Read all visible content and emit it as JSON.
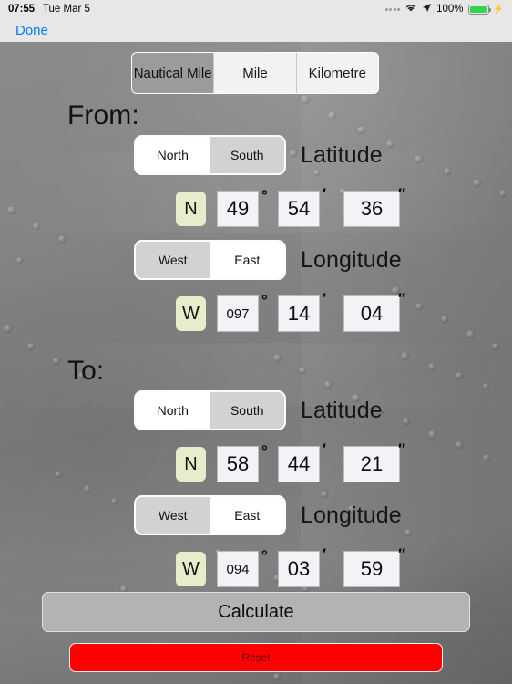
{
  "statusbar": {
    "time": "07:55",
    "date": "Tue Mar 5",
    "battery_percent": "100%",
    "signal_icon": "signal-dots-icon",
    "wifi_icon": "wifi-icon",
    "location_icon": "location-arrow-icon",
    "battery_icon": "battery-full-icon",
    "charging_icon": "charging-bolt-icon"
  },
  "navbar": {
    "done_label": "Done",
    "done_color": "#007AFF"
  },
  "unit_selector": {
    "options": [
      "Nautical Mile",
      "Mile",
      "Kilometre"
    ],
    "selected": "Nautical Mile"
  },
  "from": {
    "heading": "From:",
    "latitude": {
      "label": "Latitude",
      "options": [
        "North",
        "South"
      ],
      "selected": "North",
      "hemisphere": "N",
      "degrees": "49",
      "minutes": "54",
      "seconds": "36",
      "degree_mark": "°",
      "minute_mark": "′",
      "second_mark": "″"
    },
    "longitude": {
      "label": "Longitude",
      "options": [
        "West",
        "East"
      ],
      "selected": "East",
      "hemisphere": "W",
      "degrees": "097",
      "minutes": "14",
      "seconds": "04",
      "degree_mark": "°",
      "minute_mark": "′",
      "second_mark": "″"
    }
  },
  "to": {
    "heading": "To:",
    "latitude": {
      "label": "Latitude",
      "options": [
        "North",
        "South"
      ],
      "selected": "North",
      "hemisphere": "N",
      "degrees": "58",
      "minutes": "44",
      "seconds": "21",
      "degree_mark": "°",
      "minute_mark": "′",
      "second_mark": "″"
    },
    "longitude": {
      "label": "Longitude",
      "options": [
        "West",
        "East"
      ],
      "selected": "East",
      "hemisphere": "W",
      "degrees": "094",
      "minutes": "03",
      "seconds": "59",
      "degree_mark": "°",
      "minute_mark": "′",
      "second_mark": "″"
    }
  },
  "actions": {
    "calculate_label": "Calculate",
    "reset_label": "Reset",
    "reset_color": "#FF0000"
  }
}
